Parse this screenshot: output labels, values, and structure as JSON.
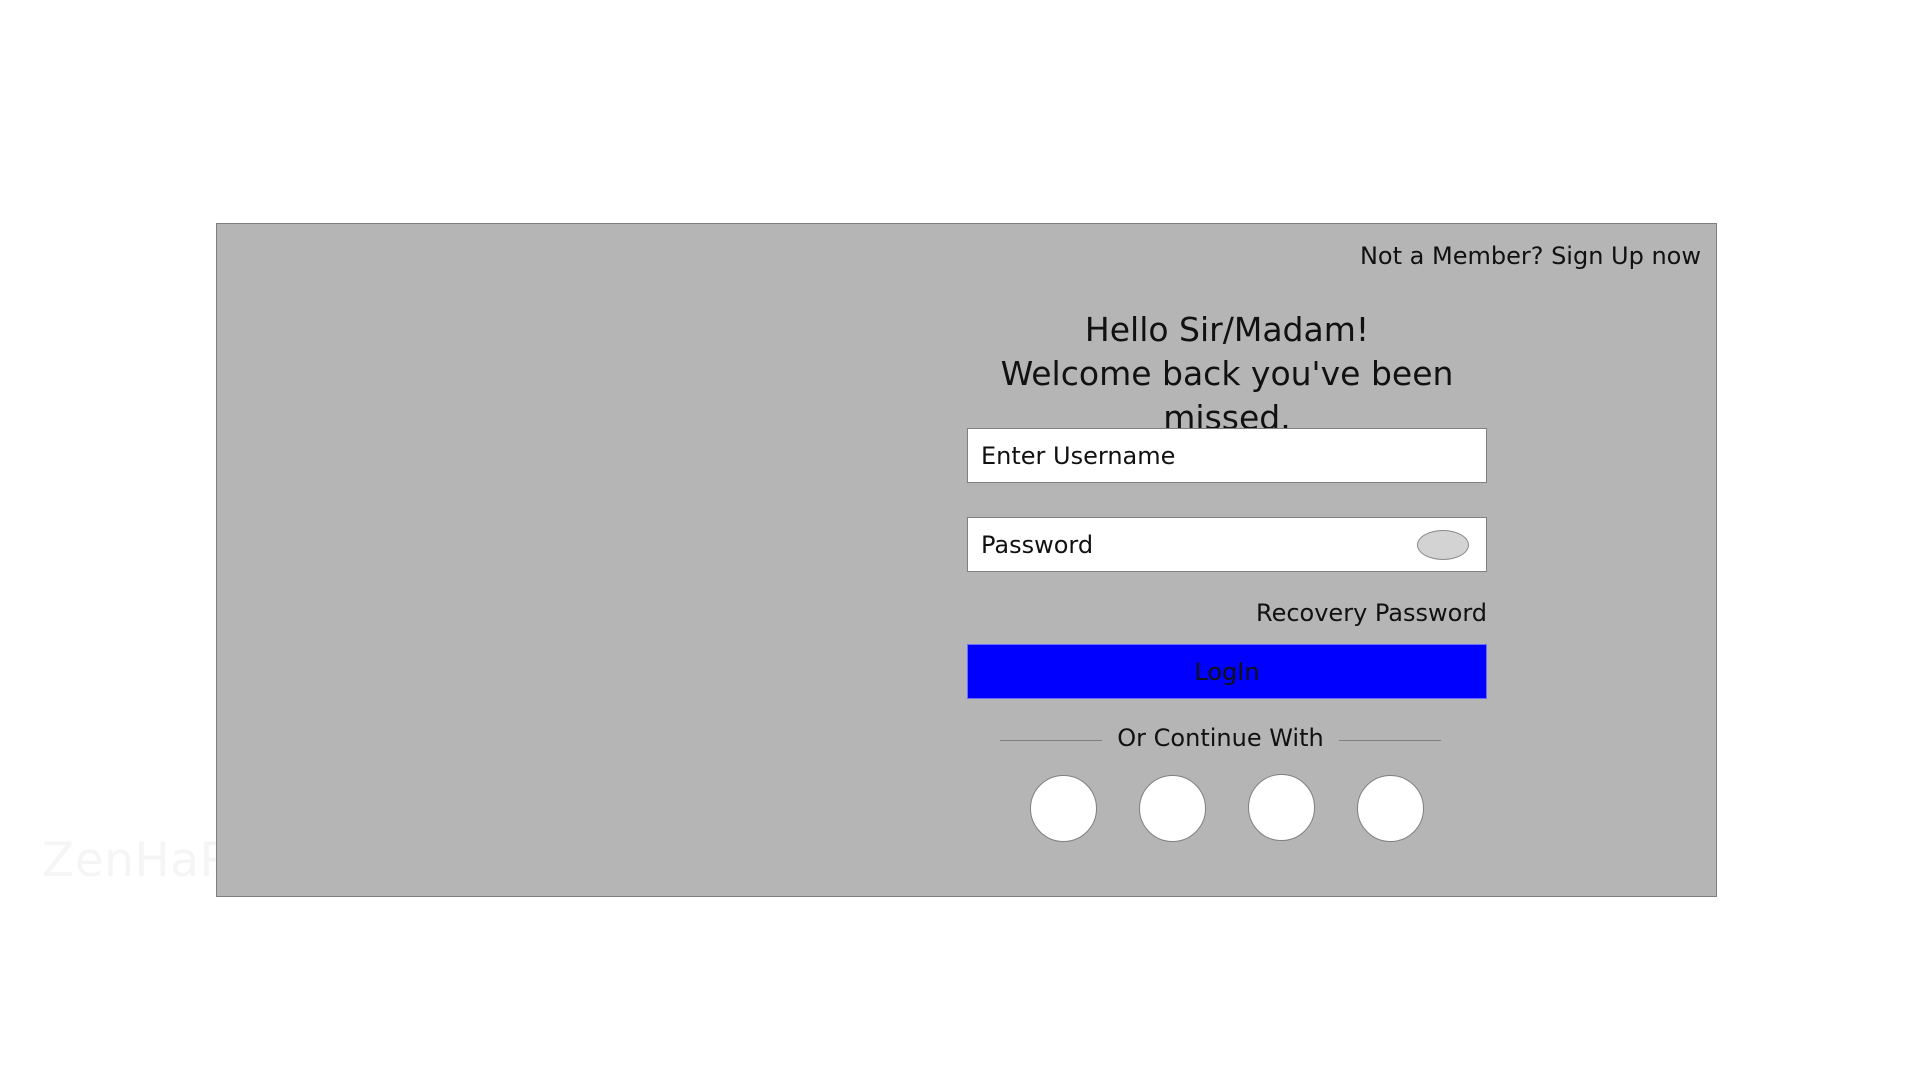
{
  "watermark": "ZenHaRa",
  "signup_link": "Not a Member? Sign Up now",
  "greeting": {
    "line1": "Hello Sir/Madam!",
    "line2": "Welcome back you've been missed."
  },
  "username_field": {
    "placeholder": "Enter Username",
    "value": ""
  },
  "password_field": {
    "placeholder": "Password",
    "value": "",
    "toggle_icon": "eye-icon"
  },
  "recovery_link": "Recovery Password",
  "login_button": {
    "label": "LogIn",
    "color": "#0000ff"
  },
  "divider_text": "Or Continue With",
  "social_buttons": [
    {
      "icon": "social-login-icon-1"
    },
    {
      "icon": "social-login-icon-2"
    },
    {
      "icon": "social-login-icon-3"
    },
    {
      "icon": "social-login-icon-4"
    }
  ],
  "colors": {
    "card_background": "#b5b5b5",
    "page_background": "#ffffff",
    "field_background": "#ffffff"
  }
}
